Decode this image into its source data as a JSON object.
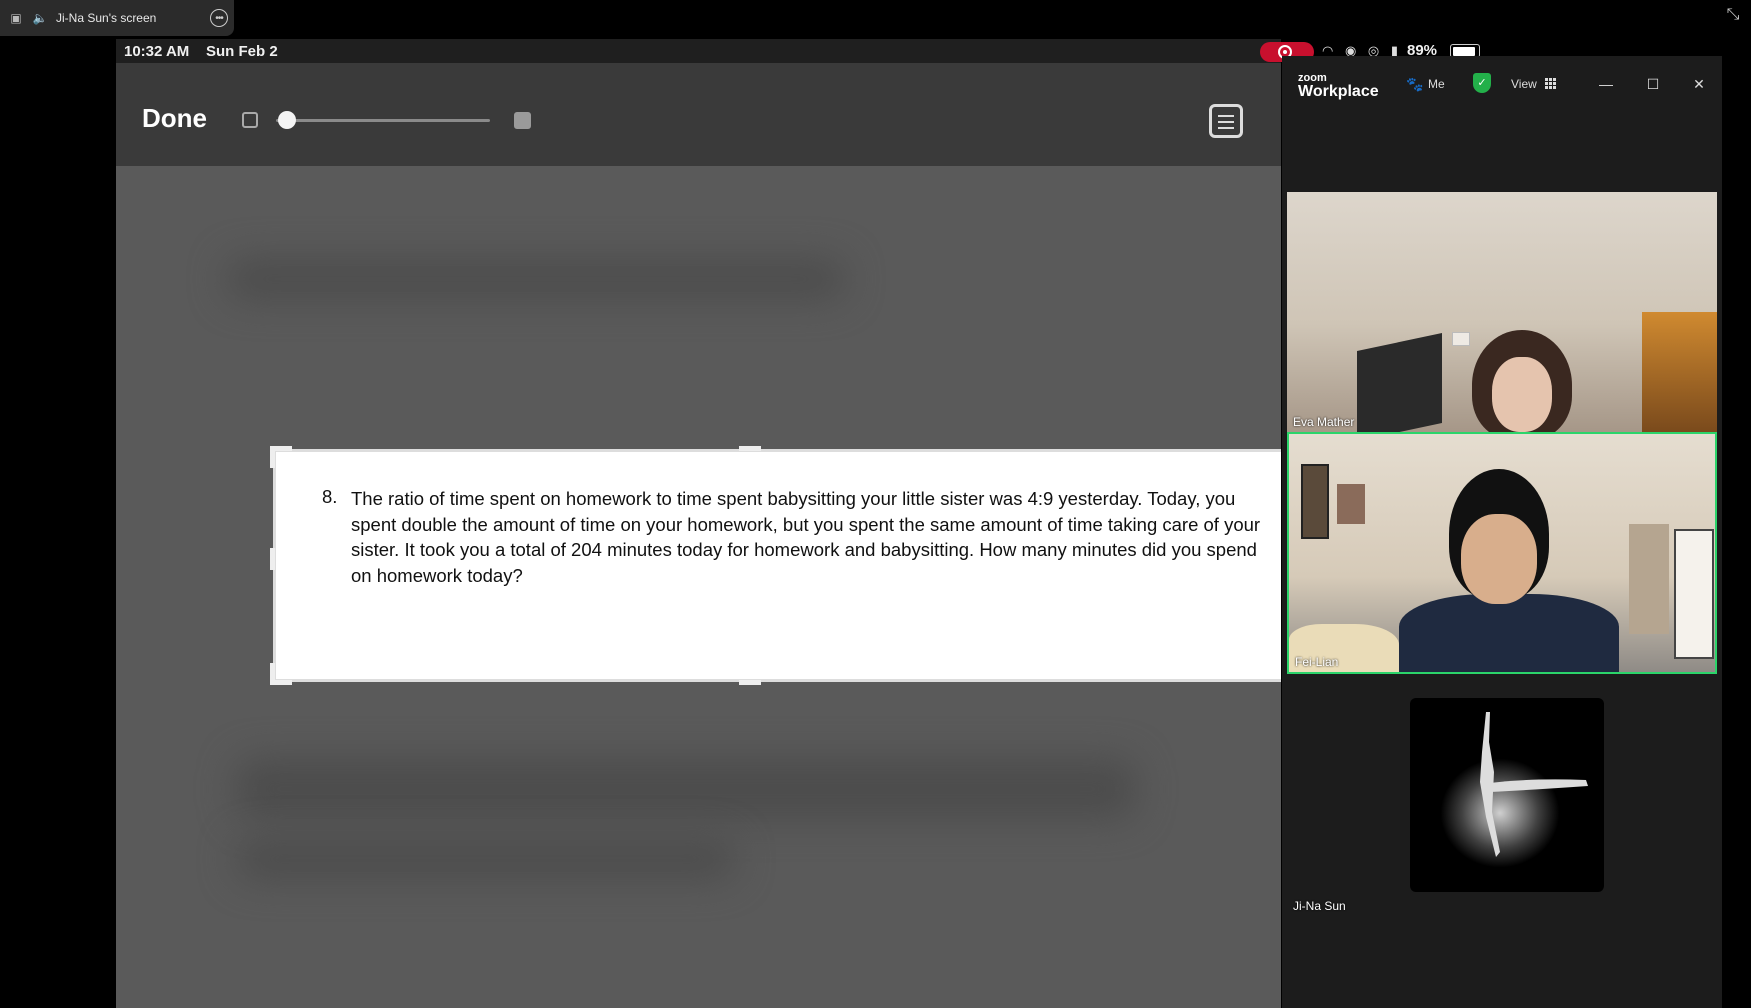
{
  "share_bar": {
    "title": "Ji-Na Sun's screen"
  },
  "ipad": {
    "time": "10:32 AM",
    "date": "Sun Feb 2",
    "done_label": "Done",
    "battery_percent": "89%",
    "question": {
      "number": "8.",
      "text": "The ratio of time spent on homework to time spent babysitting your little sister was 4:9 yesterday. Today, you spent double the amount of time on your homework, but you spent the same amount of time taking care of your sister.  It took you a total of 204 minutes today for homework and babysitting. How many minutes did you spend on homework today?"
    }
  },
  "zoom": {
    "logo_small": "zoom",
    "logo_big": "Workplace",
    "me_label": "Me",
    "view_label": "View",
    "participants": [
      {
        "name": "Eva Mather"
      },
      {
        "name": "Fei-Lian"
      },
      {
        "name": "Ji-Na Sun"
      }
    ]
  },
  "icons": {
    "share": "share-screen-icon",
    "speaker": "speaker-icon",
    "more": "more-icon",
    "collapse": "collapse-icon",
    "scan": "scan-text-icon",
    "record": "record-icon",
    "paw": "paw-icon",
    "shield": "shield-check-icon",
    "grid": "grid-view-icon",
    "minimize": "minimize-icon",
    "maximize": "maximize-icon",
    "close": "close-icon"
  },
  "colors": {
    "active_speaker_border": "#2bd46a",
    "recording": "#c8102e",
    "shield": "#23b04a"
  }
}
